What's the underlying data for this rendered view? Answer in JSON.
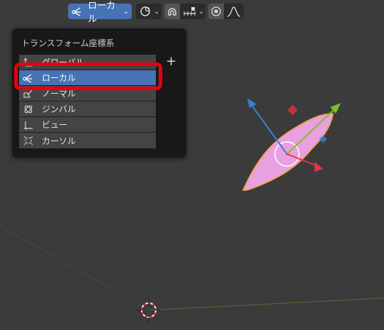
{
  "header": {
    "orientation_label": "ローカル",
    "orientation_icon": "local-orientation-icon",
    "pivot_icon": "pivot-point-icon",
    "snap_icon": "snap-magnet-icon",
    "snap_increment_icon": "snap-increment-icon",
    "proportional_icon": "proportional-edit-icon",
    "falloff_icon": "falloff-curve-icon"
  },
  "menu": {
    "title": "トランスフォーム座標系",
    "add_label": "+",
    "items": [
      {
        "label": "グローバル",
        "icon": "global-orientation-icon"
      },
      {
        "label": "ローカル",
        "icon": "local-orientation-icon",
        "active": true
      },
      {
        "label": "ノーマル",
        "icon": "normal-orientation-icon"
      },
      {
        "label": "ジンバル",
        "icon": "gimbal-orientation-icon"
      },
      {
        "label": "ビュー",
        "icon": "view-orientation-icon"
      },
      {
        "label": "カーソル",
        "icon": "cursor-orientation-icon"
      }
    ]
  },
  "colors": {
    "accent": "#4772b3",
    "highlight": "#e60012",
    "object": "#e8a0e0",
    "gizmo_x": "#e5334a",
    "gizmo_y": "#7fbf2a",
    "gizmo_z": "#3b7fd4"
  }
}
